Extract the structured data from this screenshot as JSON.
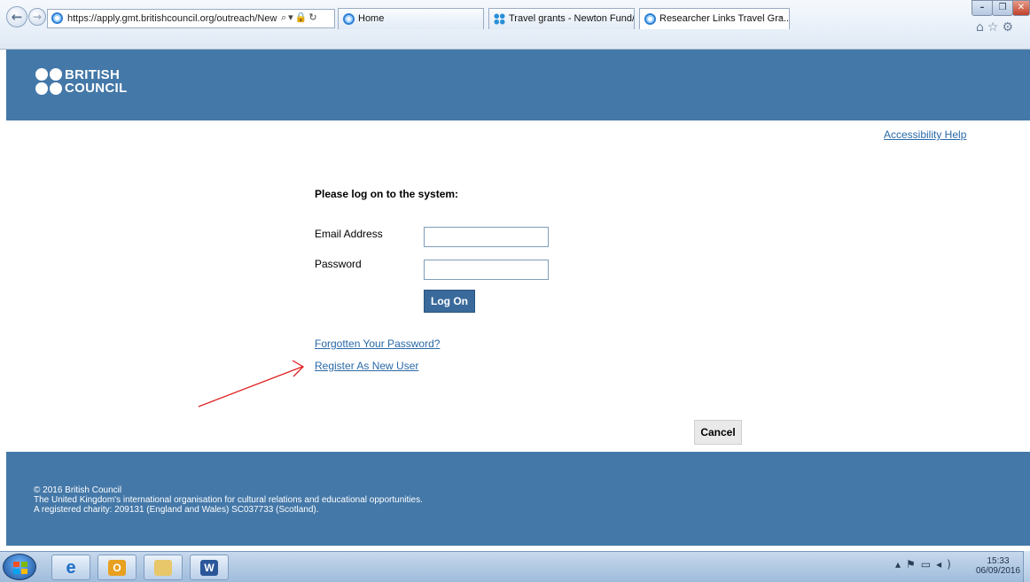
{
  "browser": {
    "url": "https://apply.gmt.britishcouncil.org/outreach/New",
    "tabs": [
      {
        "label": "Home"
      },
      {
        "label": "Travel grants - Newton Fund/..."
      },
      {
        "label": "Researcher Links Travel Gra...",
        "close": "×"
      }
    ],
    "icons": [
      "back-icon",
      "forward-icon",
      "search-icon",
      "lock-icon",
      "refresh-icon",
      "home-icon",
      "favorites-star-icon",
      "settings-gear-icon"
    ]
  },
  "header": {
    "logo_line1": "BRITISH",
    "logo_line2": "COUNCIL"
  },
  "accessibility_link": "Accessibility Help",
  "login": {
    "heading": "Please log on to the system:",
    "email_label": "Email Address",
    "email_value": "",
    "password_label": "Password",
    "password_value": "",
    "logon_button": "Log On",
    "forgot_link": "Forgotten Your Password?",
    "register_link": "Register As New User",
    "cancel_button": "Cancel"
  },
  "annotation": {
    "arrow_color": "#e02020",
    "icon": "red-arrow-icon"
  },
  "footer": {
    "line1": "© 2016 British Council",
    "line2": "The United Kingdom's international organisation for cultural relations and educational opportunities.",
    "line3": "A registered charity: 209131 (England and Wales) SC037733 (Scotland)."
  },
  "taskbar": {
    "time": "15:33",
    "date": "06/09/2016",
    "apps": [
      "windows-start-icon",
      "internet-explorer-icon",
      "outlook-icon",
      "file-explorer-icon",
      "word-icon"
    ]
  },
  "colors": {
    "brand_blue": "#4478a8",
    "link": "#2a69a8",
    "button": "#3a6a9b"
  }
}
